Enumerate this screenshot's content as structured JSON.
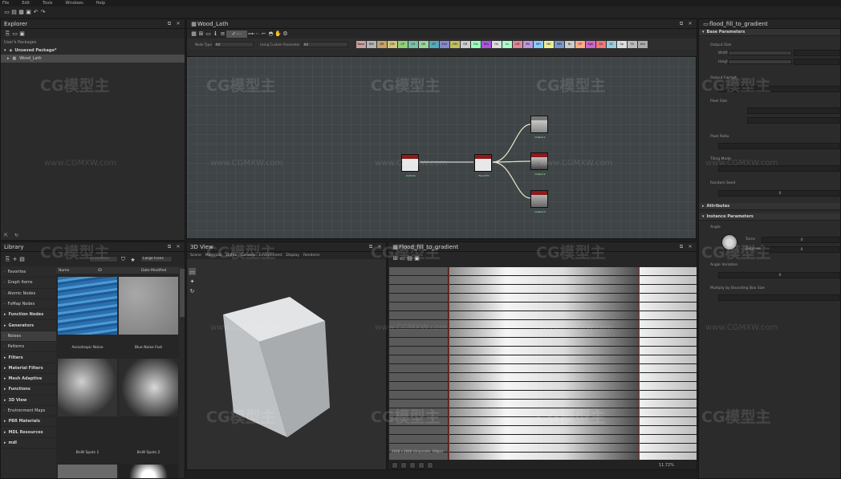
{
  "menu": [
    "File",
    "Edit",
    "Tools",
    "Windows",
    "Help"
  ],
  "explorer": {
    "title": "Explorer",
    "section": "User's Packages",
    "package": "Unsaved Package*",
    "graph": "Wood_Lath"
  },
  "graph_view": {
    "title": "Wood_Lath",
    "filter_label": "Node Type",
    "filter_value": "All",
    "params_label": "Using Custom Parameter",
    "params_value": "All",
    "chips": [
      "Base",
      "BM",
      "BR",
      "CM",
      "CP",
      "CS",
      "DS",
      "DT",
      "Emi",
      "GM",
      "GR",
      "Gls",
      "Hm",
      "Hv",
      "Lo",
      "LM",
      "Mh",
      "MH",
      "Mtl",
      "NM",
      "Nr",
      "OP",
      "Rgh",
      "Sh",
      "SC",
      "Sp",
      "TA",
      "Unt"
    ],
    "chip_colors": [
      "#c9a0a0",
      "#b4b4b4",
      "#c4a36a",
      "#d1c37a",
      "#8fd07a",
      "#7ac0a8",
      "#9ad69a",
      "#5ab",
      "#88c",
      "#c0c060",
      "#ccc",
      "#9fb",
      "#a5d",
      "#ddd",
      "#afc",
      "#d89",
      "#b9d",
      "#8cf",
      "#ee9",
      "#79c",
      "#ccc",
      "#fa8",
      "#c6c",
      "#e77",
      "#9cd",
      "#ddd",
      "#bbb",
      "#aaa"
    ],
    "nodes": [
      {
        "label": "Uniform"
      },
      {
        "label": "Flood Fill"
      },
      {
        "label": "Output 1"
      },
      {
        "label": "Output 2"
      },
      {
        "label": "Output 3"
      }
    ]
  },
  "library": {
    "title": "Library",
    "size_option": "Large Icons",
    "columns": [
      "Name",
      "ID",
      "Date Modified"
    ],
    "categories": [
      {
        "label": "Favorites",
        "bold": false
      },
      {
        "label": "Graph Items",
        "bold": false
      },
      {
        "label": "Atomic Nodes",
        "bold": false
      },
      {
        "label": "FxMap Nodes",
        "bold": false
      },
      {
        "label": "Function Nodes",
        "bold": true
      },
      {
        "label": "Generators",
        "bold": true
      },
      {
        "label": "Noises",
        "bold": false,
        "selected": true
      },
      {
        "label": "Patterns",
        "bold": false
      },
      {
        "label": "Filters",
        "bold": true
      },
      {
        "label": "Material Filters",
        "bold": true
      },
      {
        "label": "Mesh Adaptive",
        "bold": true
      },
      {
        "label": "Functions",
        "bold": true
      },
      {
        "label": "3D View",
        "bold": true
      },
      {
        "label": "Environment Maps",
        "bold": false
      },
      {
        "label": "PBR Materials",
        "bold": true
      },
      {
        "label": "MDL Resources",
        "bold": true
      },
      {
        "label": "mdl",
        "bold": true
      }
    ],
    "thumbs": [
      "Anisotropic Noise",
      "Blue Noise Fast",
      "BnW Spots 1",
      "BnW Spots 2",
      "",
      ""
    ]
  },
  "view3d": {
    "title": "3D View",
    "menu": [
      "Scene",
      "Materials",
      "Lights",
      "Camera",
      "Environment",
      "Display",
      "Renderer"
    ]
  },
  "view2d": {
    "title": "Flood_fill_to_gradient",
    "status": "2048 x 2048 (Grayscale, 16bpc)",
    "zoom": "11.72%"
  },
  "properties": {
    "title": "flood_fill_to_gradient",
    "sections": {
      "base": "Base Parameters",
      "attributes": "Attributes",
      "instance": "Instance Parameters"
    },
    "output_size": "Output Size",
    "width": "Width",
    "height": "Height",
    "output_format": "Output Format",
    "pixel_size": "Pixel Size",
    "pixel_ratio": "Pixel Ratio",
    "tiling_mode": "Tiling Mode",
    "random_seed": "Random Seed",
    "random_seed_value": "0",
    "angle": "Angle",
    "turns": "Turns",
    "turns_value": "0",
    "degrees": "Degrees",
    "degrees_value": "0",
    "angle_variation": "Angle Variation",
    "angle_variation_value": "0",
    "multiply": "Multiply by Bounding Box Size"
  },
  "watermark": {
    "logo": "CG模型主",
    "url": "www.CGMXW.com"
  }
}
